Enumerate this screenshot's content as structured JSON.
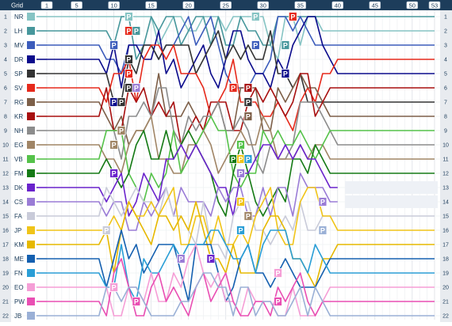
{
  "chart_data": {
    "type": "line",
    "title": "",
    "grid_header": "Grid",
    "x_tick_labels": [
      "1",
      "5",
      "10",
      "15",
      "20",
      "25",
      "30",
      "35",
      "40",
      "45",
      "50",
      "53"
    ],
    "x_tick_laps": [
      1,
      5,
      10,
      15,
      20,
      25,
      30,
      35,
      40,
      45,
      50,
      53
    ],
    "total_laps": 53,
    "y_range": [
      1,
      22
    ],
    "y_reversed": true,
    "position_labels": [
      "1",
      "2",
      "3",
      "4",
      "5",
      "6",
      "7",
      "8",
      "9",
      "10",
      "11",
      "12",
      "13",
      "14",
      "15",
      "16",
      "17",
      "18",
      "19",
      "20",
      "21",
      "22"
    ],
    "legend_placement": "left",
    "grid_lines": true,
    "pit_marker_label": "P",
    "series": [
      {
        "name": "NR",
        "grid": 1,
        "color": "#86c4c4",
        "finish": 2,
        "retired_after": null
      },
      {
        "name": "LH",
        "grid": 2,
        "color": "#47979c",
        "finish": 1,
        "retired_after": null
      },
      {
        "name": "MV",
        "grid": 3,
        "color": "#3c5cbb",
        "finish": 3,
        "retired_after": null
      },
      {
        "name": "DR",
        "grid": 4,
        "color": "#0b0b8c",
        "finish": 5,
        "retired_after": null
      },
      {
        "name": "SP",
        "grid": 5,
        "color": "#333333",
        "finish": 7,
        "retired_after": null
      },
      {
        "name": "SV",
        "grid": 6,
        "color": "#e62a1c",
        "finish": 4,
        "retired_after": null
      },
      {
        "name": "RG",
        "grid": 7,
        "color": "#7d5f48",
        "finish": 8,
        "retired_after": null
      },
      {
        "name": "KR",
        "grid": 8,
        "color": "#a80f0f",
        "finish": 6,
        "retired_after": null
      },
      {
        "name": "NH",
        "grid": 9,
        "color": "#8c8c8c",
        "finish": 10,
        "retired_after": null
      },
      {
        "name": "EG",
        "grid": 10,
        "color": "#a08566",
        "finish": 11,
        "retired_after": null
      },
      {
        "name": "VB",
        "grid": 11,
        "color": "#55c24a",
        "finish": 9,
        "retired_after": null
      },
      {
        "name": "FM",
        "grid": 12,
        "color": "#157a15",
        "finish": 12,
        "retired_after": null
      },
      {
        "name": "DK",
        "grid": 13,
        "color": "#6a23cc",
        "finish": 13,
        "retired_after": 40
      },
      {
        "name": "CS",
        "grid": 14,
        "color": "#9a7cd6",
        "finish": 14,
        "retired_after": 40
      },
      {
        "name": "FA",
        "grid": 15,
        "color": "#c9cbd9",
        "finish": 15,
        "retired_after": null
      },
      {
        "name": "JP",
        "grid": 16,
        "color": "#f0c419",
        "finish": 16,
        "retired_after": null
      },
      {
        "name": "KM",
        "grid": 17,
        "color": "#e6b800",
        "finish": 17,
        "retired_after": null
      },
      {
        "name": "ME",
        "grid": 18,
        "color": "#1560b0",
        "finish": 18,
        "retired_after": null
      },
      {
        "name": "FN",
        "grid": 19,
        "color": "#2a9ed6",
        "finish": 19,
        "retired_after": null
      },
      {
        "name": "EO",
        "grid": 20,
        "color": "#f59ed6",
        "finish": 20,
        "retired_after": null
      },
      {
        "name": "PW",
        "grid": 21,
        "color": "#e94fb3",
        "finish": 21,
        "retired_after": null
      },
      {
        "name": "JB",
        "grid": 22,
        "color": "#9ab0d6",
        "finish": 22,
        "retired_after": null
      }
    ],
    "pit_stops": [
      {
        "lap": 12,
        "position": 1,
        "color": "#86c4c4"
      },
      {
        "lap": 29,
        "position": 1,
        "color": "#86c4c4"
      },
      {
        "lap": 34,
        "position": 1,
        "color": "#e62a1c"
      },
      {
        "lap": 12,
        "position": 2,
        "color": "#e62a1c"
      },
      {
        "lap": 13,
        "position": 2,
        "color": "#47979c"
      },
      {
        "lap": 10,
        "position": 3,
        "color": "#3c5cbb"
      },
      {
        "lap": 29,
        "position": 3,
        "color": "#3c5cbb"
      },
      {
        "lap": 33,
        "position": 3,
        "color": "#47979c"
      },
      {
        "lap": 12,
        "position": 4,
        "color": "#333333"
      },
      {
        "lap": 12,
        "position": 5,
        "color": "#e62a1c"
      },
      {
        "lap": 33,
        "position": 5,
        "color": "#0b0b8c"
      },
      {
        "lap": 12,
        "position": 6,
        "color": "#333333"
      },
      {
        "lap": 13,
        "position": 6,
        "color": "#9a7cd6"
      },
      {
        "lap": 26,
        "position": 6,
        "color": "#e62a1c"
      },
      {
        "lap": 28,
        "position": 6,
        "color": "#a80f0f"
      },
      {
        "lap": 10,
        "position": 7,
        "color": "#0b0b8c"
      },
      {
        "lap": 11,
        "position": 7,
        "color": "#333333"
      },
      {
        "lap": 28,
        "position": 7,
        "color": "#333333"
      },
      {
        "lap": 28,
        "position": 8,
        "color": "#7d5f48"
      },
      {
        "lap": 11,
        "position": 9,
        "color": "#a08566"
      },
      {
        "lap": 10,
        "position": 10,
        "color": "#a08566"
      },
      {
        "lap": 27,
        "position": 10,
        "color": "#55c24a"
      },
      {
        "lap": 26,
        "position": 11,
        "color": "#157a15"
      },
      {
        "lap": 27,
        "position": 11,
        "color": "#f0c419"
      },
      {
        "lap": 28,
        "position": 11,
        "color": "#2a9ed6"
      },
      {
        "lap": 10,
        "position": 12,
        "color": "#6a23cc"
      },
      {
        "lap": 27,
        "position": 12,
        "color": "#9a7cd6"
      },
      {
        "lap": 27,
        "position": 14,
        "color": "#f0c419"
      },
      {
        "lap": 38,
        "position": 14,
        "color": "#9a7cd6"
      },
      {
        "lap": 28,
        "position": 15,
        "color": "#a08566"
      },
      {
        "lap": 9,
        "position": 16,
        "color": "#c9cbd9"
      },
      {
        "lap": 27,
        "position": 16,
        "color": "#2a9ed6"
      },
      {
        "lap": 38,
        "position": 16,
        "color": "#9ab0d6"
      },
      {
        "lap": 19,
        "position": 18,
        "color": "#9a7cd6"
      },
      {
        "lap": 23,
        "position": 18,
        "color": "#6a23cc"
      },
      {
        "lap": 32,
        "position": 19,
        "color": "#f59ed6"
      },
      {
        "lap": 10,
        "position": 20,
        "color": "#f59ed6"
      },
      {
        "lap": 13,
        "position": 21,
        "color": "#e94fb3"
      },
      {
        "lap": 32,
        "position": 21,
        "color": "#e94fb3"
      }
    ]
  }
}
